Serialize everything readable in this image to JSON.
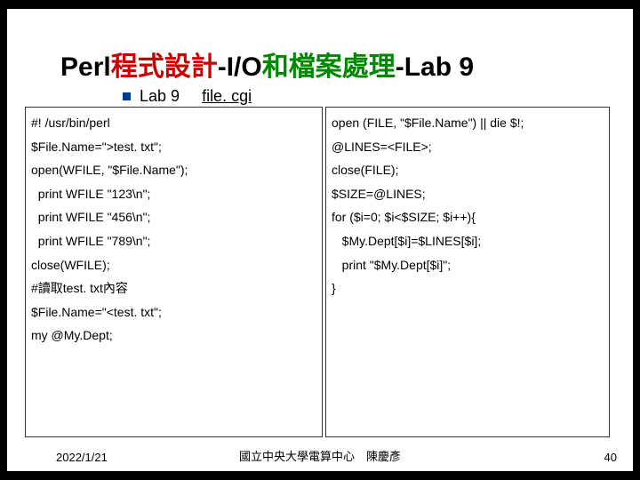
{
  "title": {
    "part1": "Perl",
    "part2": "程式設計",
    "part3": "-I/O",
    "part4": "和檔案處理",
    "part5": "-Lab 9"
  },
  "subtitle": {
    "label": "Lab 9",
    "filename": "file. cgi"
  },
  "code_left": [
    "#! /usr/bin/perl",
    "$File.Name=\">test. txt\";",
    "open(WFILE, \"$File.Name\");",
    "  print WFILE \"123\\n\";",
    "  print WFILE \"456\\n\";",
    "  print WFILE \"789\\n\";",
    "close(WFILE);",
    "#讀取test. txt內容\n$File.Name=\"<test. txt\";",
    "my @My.Dept;"
  ],
  "code_right": [
    "open (FILE, \"$File.Name\") || die $!;",
    "@LINES=<FILE>;",
    "close(FILE);",
    "$SIZE=@LINES;",
    "",
    "for ($i=0; $i<$SIZE; $i++){",
    "   $My.Dept[$i]=$LINES[$i];",
    "   print \"$My.Dept[$i]\";",
    "}"
  ],
  "footer": {
    "date": "2022/1/21",
    "center": "國立中央大學電算中心　陳慶彥",
    "page": "40"
  }
}
